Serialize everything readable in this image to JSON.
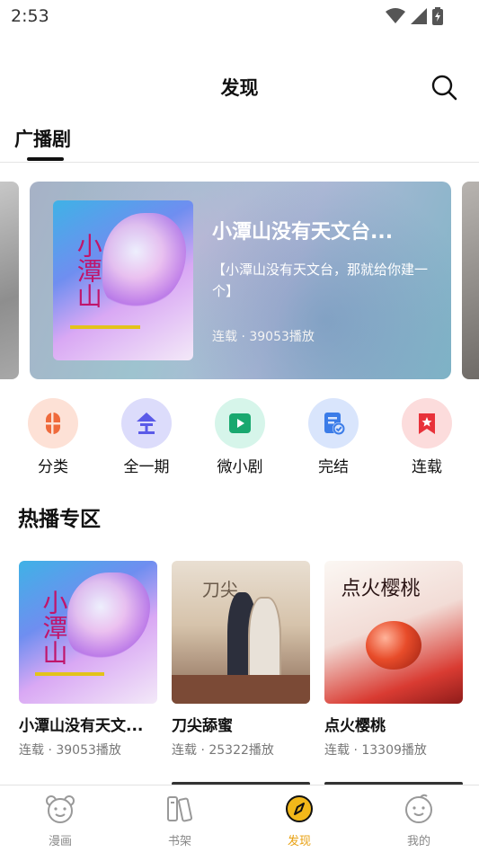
{
  "status_bar": {
    "time": "2:53"
  },
  "header": {
    "title": "发现",
    "search_icon": "search-icon"
  },
  "tabs": [
    {
      "label": "广播剧",
      "active": true
    }
  ],
  "banner": {
    "title": "小潭山没有天文台...",
    "description": "【小潭山没有天文台，那就给你建一个】",
    "meta": "连载 · 39053播放"
  },
  "categories": [
    {
      "label": "分类",
      "icon": "capsule-icon",
      "bg": "#fde1d6",
      "color": "#ef6a3c"
    },
    {
      "label": "全一期",
      "icon": "quan-character-icon",
      "bg": "#dcdcfb",
      "color": "#5a5ae8"
    },
    {
      "label": "微小剧",
      "icon": "play-icon",
      "bg": "#d6f5ea",
      "color": "#19a86f"
    },
    {
      "label": "完结",
      "icon": "completed-doc-icon",
      "bg": "#d9e5fc",
      "color": "#3b7ce8"
    },
    {
      "label": "连载",
      "icon": "bookmark-star-icon",
      "bg": "#fcdcdc",
      "color": "#e8323a"
    }
  ],
  "hot_section": {
    "title": "热播专区",
    "items": [
      {
        "title": "小潭山没有天文...",
        "meta": "连载 · 39053播放"
      },
      {
        "title": "刀尖舔蜜",
        "meta": "连载 · 25322播放"
      },
      {
        "title": "点火樱桃",
        "meta": "连载 · 13309播放"
      }
    ]
  },
  "bottom_nav": [
    {
      "label": "漫画",
      "icon": "bear-face-icon",
      "active": false
    },
    {
      "label": "书架",
      "icon": "books-icon",
      "active": false
    },
    {
      "label": "发现",
      "icon": "compass-icon",
      "active": true
    },
    {
      "label": "我的",
      "icon": "profile-face-icon",
      "active": false
    }
  ],
  "colors": {
    "accent": "#f2b81a",
    "active_nav_text": "#e8a010",
    "text": "#111111",
    "muted": "#777777"
  }
}
